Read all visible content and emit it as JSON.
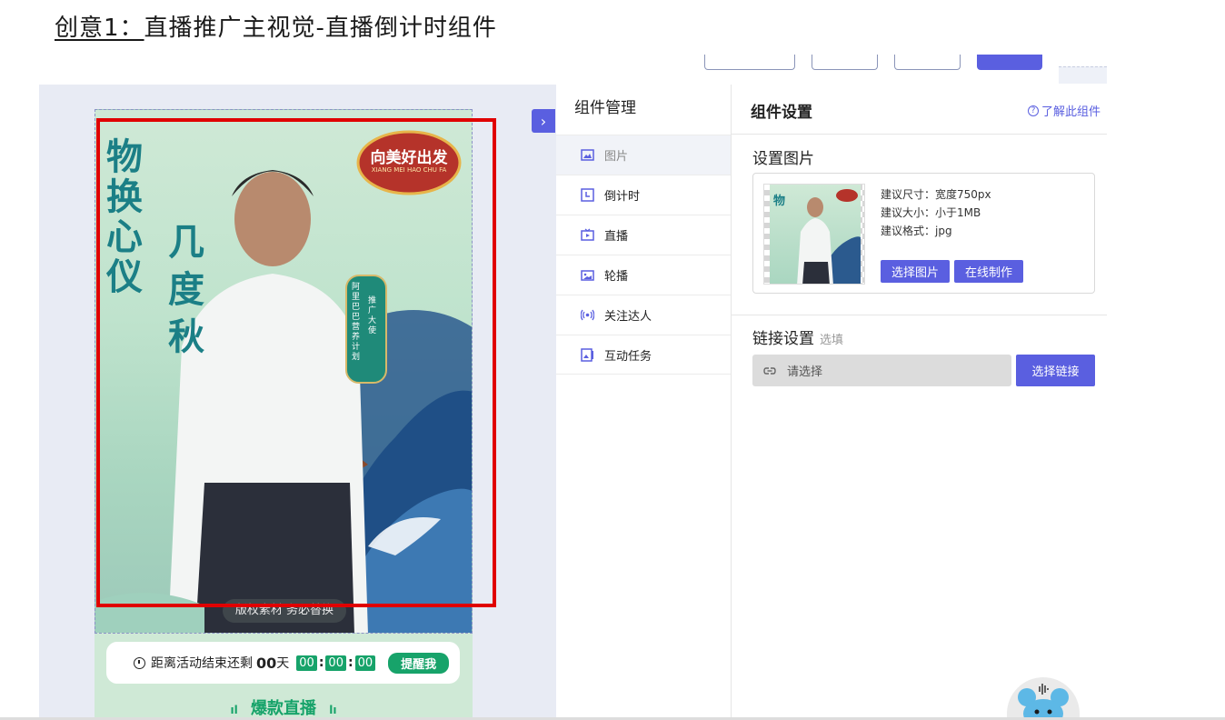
{
  "doc": {
    "title_prefix": "创意1：",
    "title_main": "直播推广主视觉-直播倒计时组件"
  },
  "poster": {
    "calligraphy_lines": [
      "物",
      "换",
      "心",
      "仪",
      "几",
      "度",
      "秋"
    ],
    "badge_main": "向美好出发",
    "badge_sub": "XIANG MEI HAO CHU FA",
    "banner_lines": [
      "阿里巴巴营养计划",
      "推广大使"
    ],
    "overlay_text": "版权素材 务必替换"
  },
  "countdown": {
    "label": "距离活动结束还剩",
    "days": "00",
    "days_unit": "天",
    "hours": "00",
    "minutes": "00",
    "seconds": "00",
    "remind_button": "提醒我",
    "live_title": "爆款直播",
    "accent_color": "#17a36a"
  },
  "components": {
    "title": "组件管理",
    "items": [
      {
        "label": "图片",
        "icon": "image-icon",
        "active": true
      },
      {
        "label": "倒计时",
        "icon": "countdown-icon"
      },
      {
        "label": "直播",
        "icon": "live-tv-icon"
      },
      {
        "label": "轮播",
        "icon": "carousel-icon"
      },
      {
        "label": "关注达人",
        "icon": "broadcast-icon"
      },
      {
        "label": "互动任务",
        "icon": "task-icon"
      }
    ]
  },
  "settings": {
    "title": "组件设置",
    "help_link": "了解此组件",
    "image_section_title": "设置图片",
    "spec_size": "建议尺寸：宽度750px",
    "spec_filesize": "建议大小：小于1MB",
    "spec_format": "建议格式：jpg",
    "choose_image_button": "选择图片",
    "online_make_button": "在线制作",
    "link_section_title": "链接设置",
    "link_optional": "选填",
    "link_placeholder": "请选择",
    "choose_link_button": "选择链接",
    "accent_color": "#5a5fe0"
  }
}
